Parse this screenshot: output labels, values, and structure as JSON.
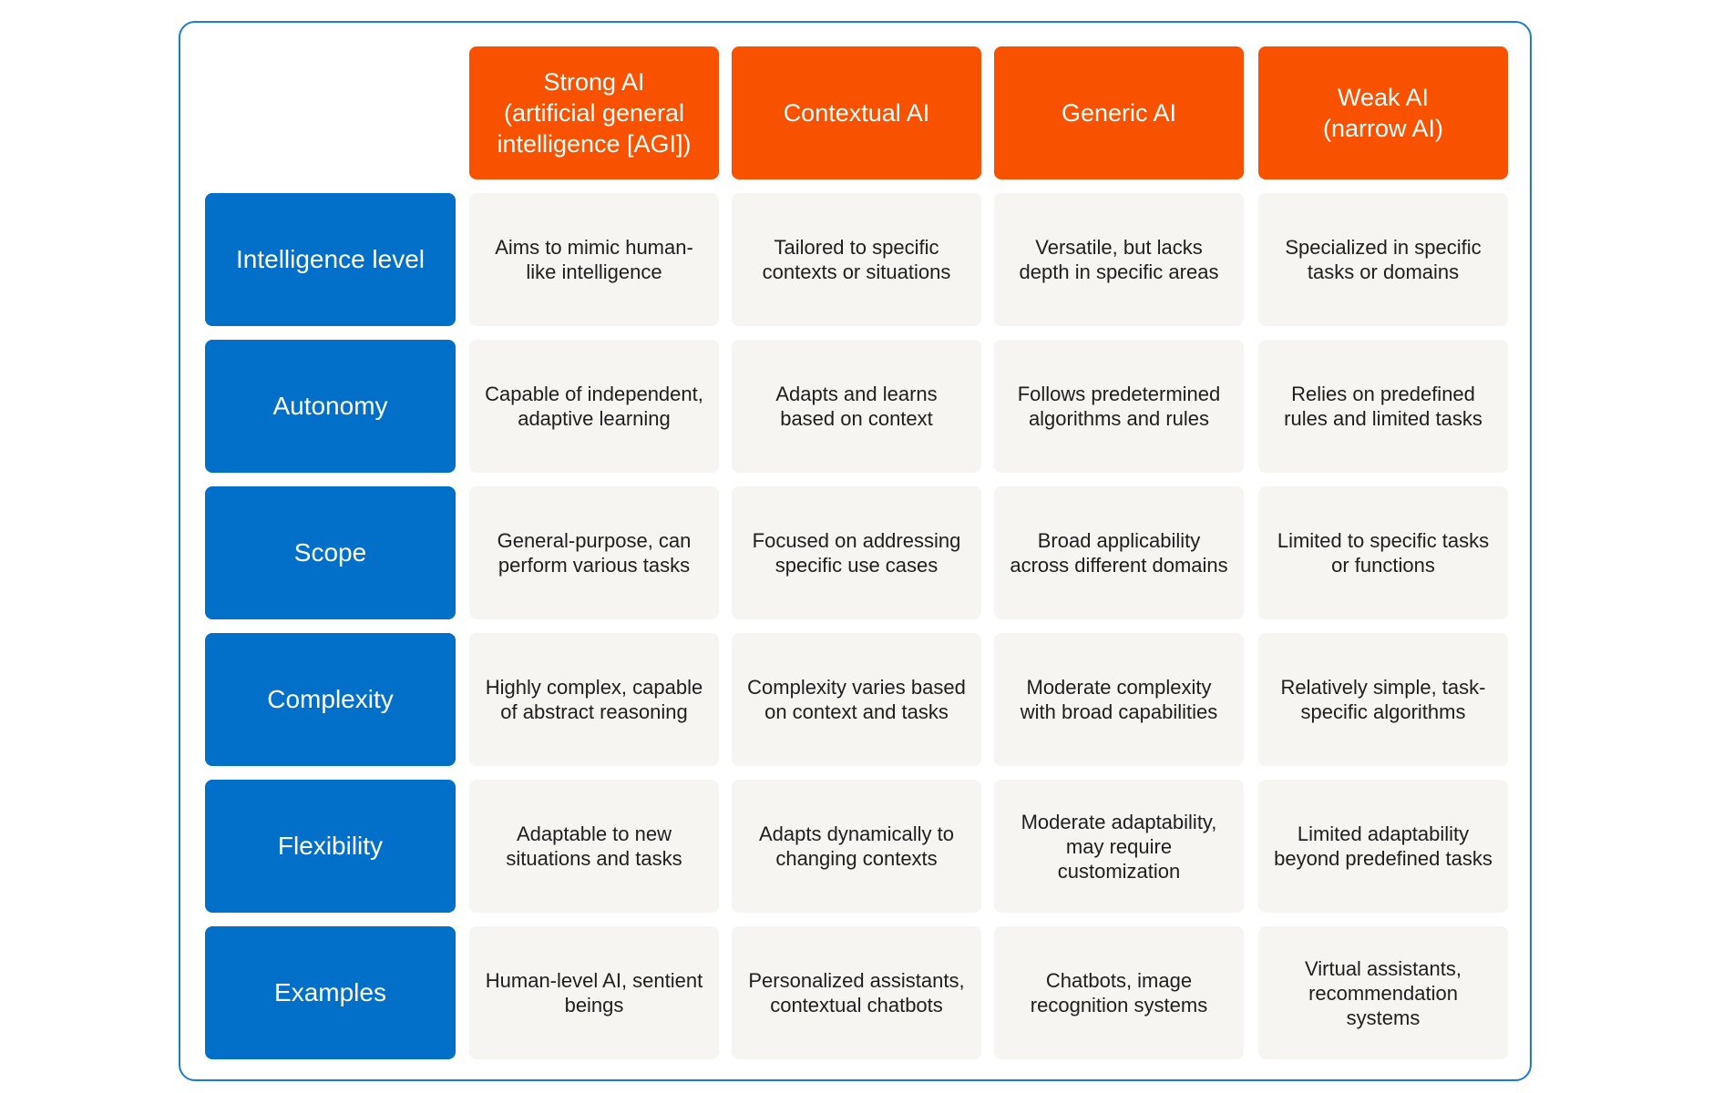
{
  "colors": {
    "header_bg": "#f85200",
    "row_label_bg": "#0270c8",
    "cell_bg": "#f6f5f1",
    "frame_border": "#1a7bd0"
  },
  "columns": [
    "Strong AI\n(artificial general intelligence [AGI])",
    "Contextual AI",
    "Generic AI",
    "Weak AI\n(narrow AI)"
  ],
  "rows": [
    {
      "label": "Intelligence level",
      "cells": [
        "Aims to mimic human-like intelligence",
        "Tailored to specific contexts or situations",
        "Versatile, but lacks depth in specific areas",
        "Specialized in specific tasks or domains"
      ]
    },
    {
      "label": "Autonomy",
      "cells": [
        "Capable of independent, adaptive learning",
        "Adapts and learns based on context",
        "Follows predetermined algorithms and rules",
        "Relies on predefined rules and limited tasks"
      ]
    },
    {
      "label": "Scope",
      "cells": [
        "General-purpose, can perform various tasks",
        "Focused on addressing specific use cases",
        "Broad applicability across different domains",
        "Limited to specific tasks or functions"
      ]
    },
    {
      "label": "Complexity",
      "cells": [
        "Highly complex, capable of abstract reasoning",
        "Complexity varies based on context and tasks",
        "Moderate complexity with broad capabilities",
        "Relatively simple, task-specific algorithms"
      ]
    },
    {
      "label": "Flexibility",
      "cells": [
        "Adaptable to new situations and tasks",
        "Adapts dynamically to changing contexts",
        "Moderate adaptability, may require customization",
        "Limited adaptability beyond predefined tasks"
      ]
    },
    {
      "label": "Examples",
      "cells": [
        "Human-level AI, sentient beings",
        "Personalized assistants, contextual chatbots",
        "Chatbots, image recognition systems",
        "Virtual assistants, recommendation systems"
      ]
    }
  ]
}
